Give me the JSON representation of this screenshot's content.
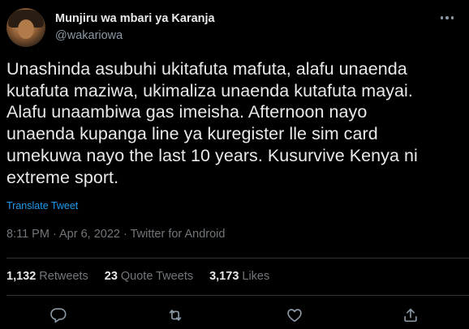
{
  "author": {
    "display_name": "Munjiru wa mbari ya Karanja",
    "handle": "@wakariowa",
    "avatar_icon": "profile-photo"
  },
  "tweet": {
    "text": "Unashinda asubuhi ukitafuta mafuta, alafu unaenda\nkutafuta maziwa, ukimaliza unaenda kutafuta mayai.\nAlafu unaambiwa gas imeisha. Afternoon nayo\nunaenda kupanga line ya kuregister lle sim card\numekuwa nayo the last 10 years. Kusurvive Kenya ni\nextreme sport.",
    "translate_label": "Translate Tweet",
    "meta": "8:11 PM · Apr 6, 2022 · Twitter for Android"
  },
  "stats": {
    "retweets_count": "1,132",
    "retweets_label": "Retweets",
    "quotes_count": "23",
    "quotes_label": "Quote Tweets",
    "likes_count": "3,173",
    "likes_label": "Likes"
  },
  "actions": [
    "reply-icon",
    "retweet-icon",
    "like-icon",
    "share-icon"
  ],
  "colors": {
    "background": "#000000",
    "text": "#e7e9ea",
    "secondary": "#71767b",
    "link": "#1d9bf0",
    "divider": "#2f3336"
  }
}
